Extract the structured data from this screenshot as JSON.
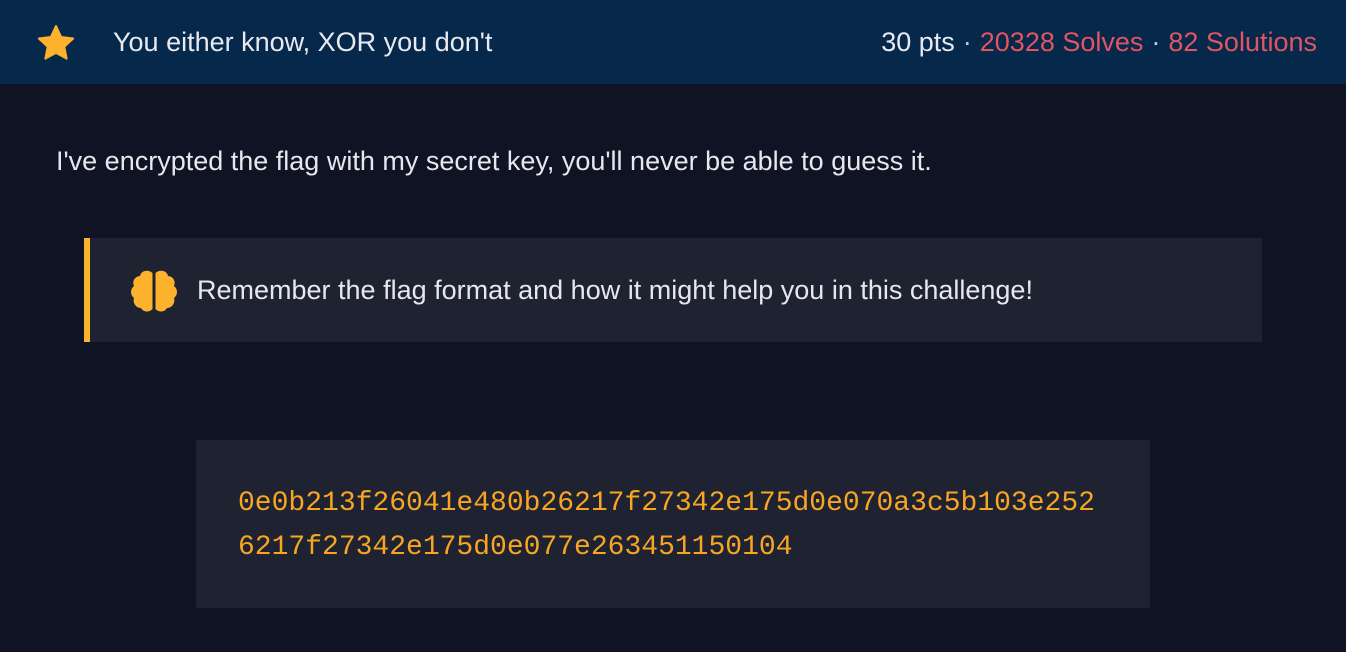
{
  "header": {
    "star_icon": "star-icon",
    "title": "You either know, XOR you don't",
    "points": "30 pts",
    "separator": "·",
    "solves": "20328 Solves",
    "solutions": "82 Solutions"
  },
  "description": "I've encrypted the flag with my secret key, you'll never be able to guess it.",
  "hint": {
    "icon": "brain-icon",
    "text": "Remember the flag format and how it might help you in this challenge!"
  },
  "ciphertext": {
    "line1": "0e0b213f26041e480b26217f27342e175d0e070a3c5b103e252",
    "line2": "6217f27342e175d0e077e263451150104"
  },
  "colors": {
    "header_bg": "#06284b",
    "page_bg": "#0f1323",
    "accent": "#fcb22c",
    "stats_red": "#e15563",
    "code_color": "#f8a522"
  }
}
